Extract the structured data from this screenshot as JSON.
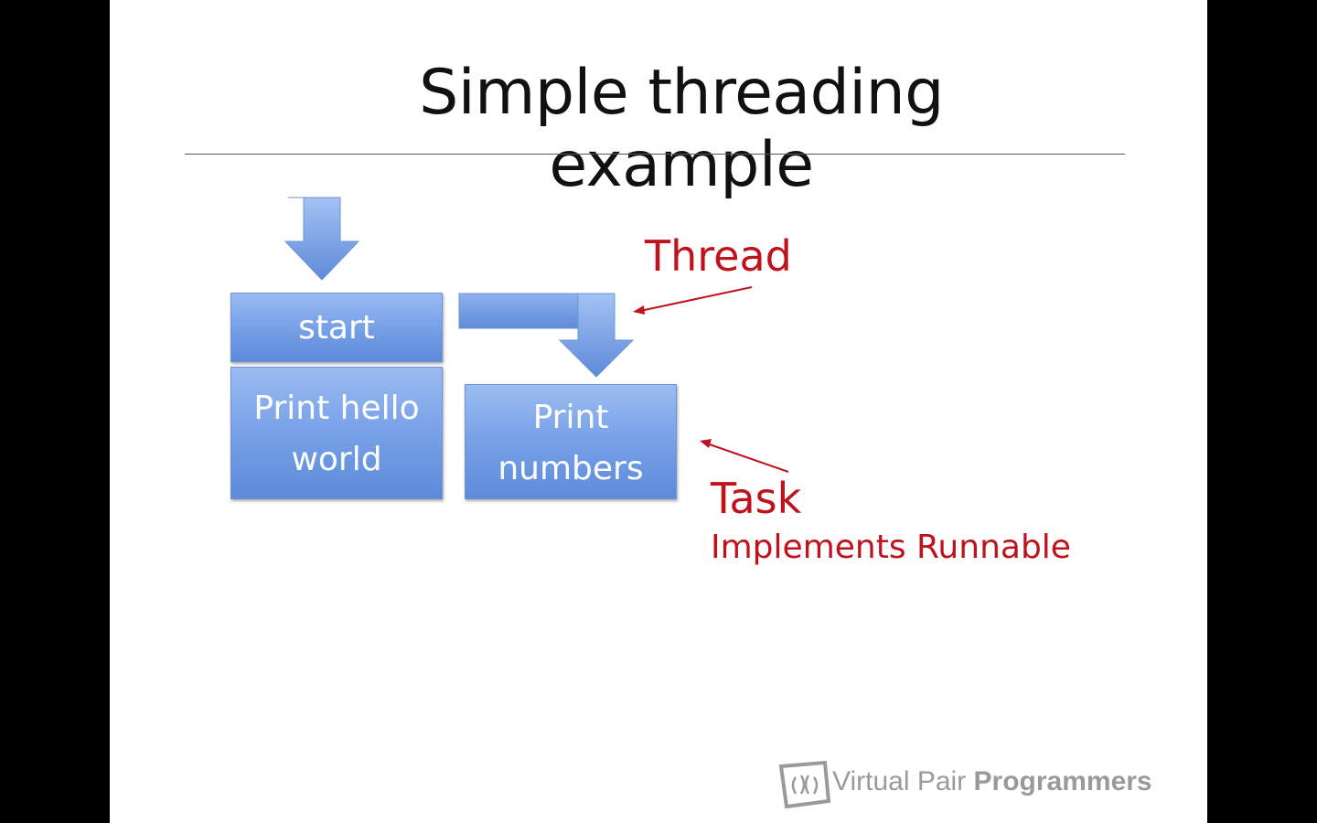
{
  "slide": {
    "title": "Simple threading example"
  },
  "diagram": {
    "boxes": {
      "start": "start",
      "hello_line1": "Print hello",
      "hello_line2": "world",
      "numbers_line1": "Print",
      "numbers_line2": "numbers"
    },
    "labels": {
      "thread": "Thread",
      "task": "Task",
      "implements": "Implements Runnable"
    },
    "colors": {
      "box_fill": "#7aa3e8",
      "label_red": "#c0121c"
    }
  },
  "logo": {
    "brand_light": "Virtual Pair",
    "brand_bold": "Programmers"
  }
}
